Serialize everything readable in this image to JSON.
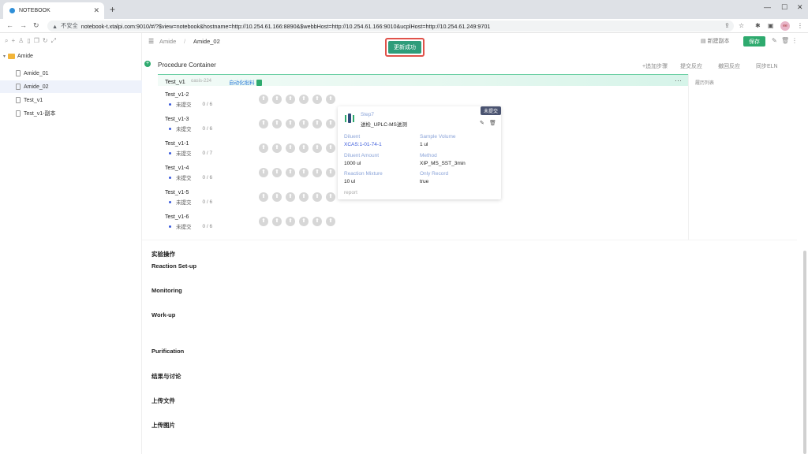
{
  "browser": {
    "tab_title": "NOTEBOOK",
    "tab_close": "✕",
    "new_tab": "+",
    "url_security": "不安全",
    "url": "notebook-t.xtalpi.com:9010/#/?$view=notebook&hostname=http://10.254.61.166:8890&$webbHost=http://10.254.61.166:9010&ucplHost=http://10.254.61.249:9701",
    "avatar": "ee"
  },
  "sidebar": {
    "folder": "Amide",
    "items": [
      {
        "label": "Amide_01"
      },
      {
        "label": "Amide_02"
      },
      {
        "label": "Test_v1"
      },
      {
        "label": "Test_v1-副本"
      }
    ]
  },
  "header": {
    "breadcrumb_parent": "Amide",
    "breadcrumb_separator": "/",
    "breadcrumb_current": "Amide_02",
    "toast": "更新成功",
    "copy_label": "新建副本",
    "save_label": "保存"
  },
  "procedure": {
    "title": "Procedure Container",
    "actions": [
      "+追加步骤",
      "提交反应",
      "撤回反应",
      "同步ELN"
    ],
    "name": "Test_v1",
    "tag": "oasis-224",
    "auto_label": "自动化批料",
    "more": "···",
    "side_title": "履历列表",
    "rows": [
      {
        "name": "Test_v1-2",
        "status": "未提交",
        "progress": "0 / 6"
      },
      {
        "name": "Test_v1-3",
        "status": "未提交",
        "progress": "0 / 6"
      },
      {
        "name": "Test_v1-1",
        "status": "未提交",
        "progress": "0 / 7"
      },
      {
        "name": "Test_v1-4",
        "status": "未提交",
        "progress": "0 / 6"
      },
      {
        "name": "Test_v1-5",
        "status": "未提交",
        "progress": "0 / 6"
      },
      {
        "name": "Test_v1-6",
        "status": "未提交",
        "progress": "0 / 6"
      }
    ]
  },
  "card": {
    "badge": "未提交",
    "step": "Step7",
    "step_title": "送检_UPLC-MS送测",
    "diluent_label": "Diluent",
    "diluent_value": "XCAS:1-01-74-1",
    "sample_volume_label": "Sample Volume",
    "sample_volume_value": "1 ul",
    "diluent_amount_label": "Diluent Amount",
    "diluent_amount_value": "1000 ul",
    "method_label": "Method",
    "method_value": "XIP_MS_SST_3min",
    "reaction_mixture_label": "Reaction Mixture",
    "reaction_mixture_value": "10 ul",
    "only_record_label": "Only Record",
    "only_record_value": "true",
    "report_label": "report"
  },
  "sections": {
    "s1": "实验操作",
    "s2": "Reaction Set-up",
    "s3": "Monitoring",
    "s4": "Work-up",
    "s5": "Purification",
    "s6": "结果与讨论",
    "s7": "上传文件",
    "s8": "上传图片"
  },
  "colors": {
    "accent_green": "#2eaa6e",
    "toast_bg": "#2e9c7a",
    "toast_border": "#e0524a",
    "badge_bg": "#4a5370"
  }
}
